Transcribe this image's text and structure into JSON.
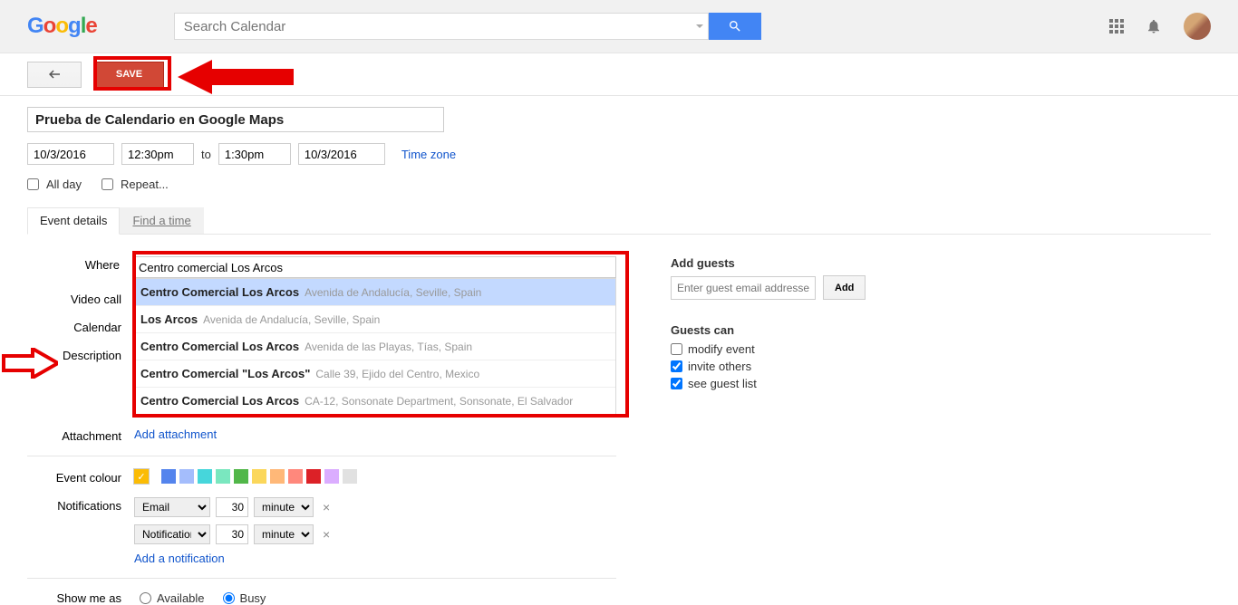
{
  "header": {
    "search_placeholder": "Search Calendar"
  },
  "toolbar": {
    "save_label": "SAVE"
  },
  "event": {
    "title": "Prueba de Calendario en Google Maps",
    "start_date": "10/3/2016",
    "start_time": "12:30pm",
    "to_label": "to",
    "end_time": "1:30pm",
    "end_date": "10/3/2016",
    "timezone_label": "Time zone",
    "allday_label": "All day",
    "repeat_label": "Repeat..."
  },
  "tabs": {
    "details": "Event details",
    "findtime": "Find a time"
  },
  "labels": {
    "where": "Where",
    "videocall": "Video call",
    "calendar": "Calendar",
    "description": "Description",
    "attachment": "Attachment",
    "colour": "Event colour",
    "notifications": "Notifications",
    "showmeas": "Show me as"
  },
  "where": {
    "value": "Centro comercial Los Arcos",
    "suggestions": [
      {
        "name": "Centro Comercial Los Arcos",
        "addr": "Avenida de Andalucía, Seville, Spain"
      },
      {
        "name": "Los Arcos",
        "addr": "Avenida de Andalucía, Seville, Spain"
      },
      {
        "name": "Centro Comercial Los Arcos",
        "addr": "Avenida de las Playas, Tías, Spain"
      },
      {
        "name": "Centro Comercial \"Los Arcos\"",
        "addr": "Calle 39, Ejido del Centro, Mexico"
      },
      {
        "name": "Centro Comercial Los Arcos",
        "addr": "CA-12, Sonsonate Department, Sonsonate, El Salvador"
      }
    ]
  },
  "attachment": {
    "add_label": "Add attachment"
  },
  "colours": [
    "#fbbc05",
    "#5484ed",
    "#a4bdfc",
    "#46d6db",
    "#7ae7bf",
    "#51b749",
    "#fbd75b",
    "#ffb878",
    "#ff887c",
    "#dc2127",
    "#dbadff",
    "#e1e1e1"
  ],
  "notifications": {
    "rows": [
      {
        "type": "Email",
        "value": "30",
        "unit": "minutes"
      },
      {
        "type": "Notification",
        "value": "30",
        "unit": "minutes"
      }
    ],
    "add_label": "Add a notification"
  },
  "showme": {
    "available": "Available",
    "busy": "Busy"
  },
  "guests": {
    "heading": "Add guests",
    "placeholder": "Enter guest email addresses",
    "add_label": "Add",
    "can_heading": "Guests can",
    "modify_label": "modify event",
    "invite_label": "invite others",
    "seelist_label": "see guest list"
  }
}
